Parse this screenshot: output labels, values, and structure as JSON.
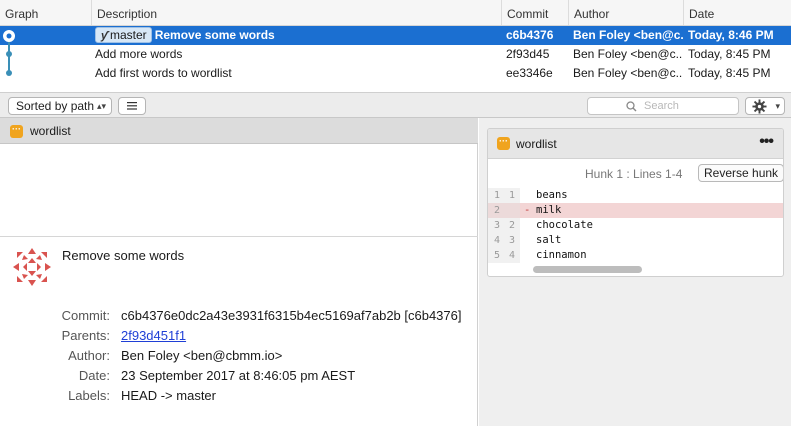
{
  "history": {
    "columns": [
      "Graph",
      "Description",
      "Commit",
      "Author",
      "Date"
    ],
    "rows": [
      {
        "branch": "master",
        "description": "Remove some words",
        "commit": "c6b4376",
        "author": "Ben Foley <ben@c...",
        "date": "Today, 8:46 PM",
        "selected": true
      },
      {
        "branch": "",
        "description": "Add more words",
        "commit": "2f93d45",
        "author": "Ben Foley <ben@c...",
        "date": "Today, 8:45 PM",
        "selected": false
      },
      {
        "branch": "",
        "description": "Add first words to wordlist",
        "commit": "ee3346e",
        "author": "Ben Foley <ben@c...",
        "date": "Today, 8:45 PM",
        "selected": false
      }
    ],
    "graph_color": "#3a8fb7",
    "selection_color": "#1b6fd1"
  },
  "toolbar": {
    "sort_label": "Sorted by path",
    "search_placeholder": "Search",
    "icons": {
      "list": "list-icon",
      "search": "search-icon",
      "settings": "gear-icon"
    }
  },
  "files": [
    {
      "name": "wordlist",
      "icon": "file-icon",
      "icon_color": "#f0a41e"
    }
  ],
  "commit_details": {
    "title": "Remove some words",
    "labels": {
      "commit": "Commit:",
      "parents": "Parents:",
      "author": "Author:",
      "date": "Date:",
      "labels": "Labels:"
    },
    "commit": "c6b4376e0dc2a43e3931f6315b4ec5169af7ab2b [c6b4376]",
    "parents": "2f93d451f1",
    "author": "Ben Foley <ben@cbmm.io>",
    "date": "23 September 2017 at 8:46:05 pm AEST",
    "refs": "HEAD -> master",
    "avatar_color": "#d9534f"
  },
  "diff": {
    "file": "wordlist",
    "more_label": "•••",
    "hunk_label": "Hunk 1 : Lines 1-4",
    "reverse_label": "Reverse hunk",
    "lines": [
      {
        "old": "1",
        "new": "1",
        "mark": "",
        "text": "beans",
        "type": "context"
      },
      {
        "old": "2",
        "new": "",
        "mark": "-",
        "text": "milk",
        "type": "removed"
      },
      {
        "old": "3",
        "new": "2",
        "mark": "",
        "text": "chocolate",
        "type": "context"
      },
      {
        "old": "4",
        "new": "3",
        "mark": "",
        "text": "salt",
        "type": "context"
      },
      {
        "old": "5",
        "new": "4",
        "mark": "",
        "text": "cinnamon",
        "type": "context"
      }
    ],
    "removed_color": "#f3d5d5"
  }
}
